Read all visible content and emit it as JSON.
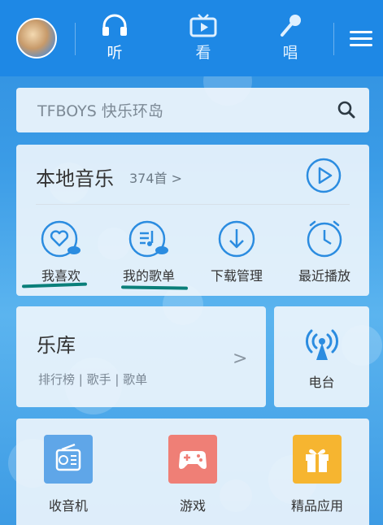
{
  "header": {
    "tabs": [
      {
        "label": "听",
        "icon": "headphones-icon",
        "active": true
      },
      {
        "label": "看",
        "icon": "tv-icon",
        "active": false
      },
      {
        "label": "唱",
        "icon": "microphone-icon",
        "active": false
      }
    ],
    "menu_icon": "menu-icon",
    "accent_color": "#1e88e5"
  },
  "search": {
    "placeholder": "TFBOYS 快乐环岛",
    "icon": "search-icon"
  },
  "local_music": {
    "title": "本地音乐",
    "count": "374首 >",
    "quick_items": [
      {
        "label": "我喜欢",
        "icon": "heart-cloud-icon"
      },
      {
        "label": "我的歌单",
        "icon": "playlist-cloud-icon"
      },
      {
        "label": "下载管理",
        "icon": "download-icon"
      },
      {
        "label": "最近播放",
        "icon": "clock-icon"
      }
    ]
  },
  "library": {
    "title": "乐库",
    "subtitle": "排行榜 | 歌手 | 歌单",
    "arrow": ">"
  },
  "radio": {
    "label": "电台",
    "icon": "broadcast-icon"
  },
  "apps": [
    {
      "label": "收音机",
      "icon": "radio-icon",
      "color": "#5fa6e8"
    },
    {
      "label": "游戏",
      "icon": "gamepad-icon",
      "color": "#ef7f76"
    },
    {
      "label": "精品应用",
      "icon": "gift-icon",
      "color": "#f6b530"
    }
  ]
}
